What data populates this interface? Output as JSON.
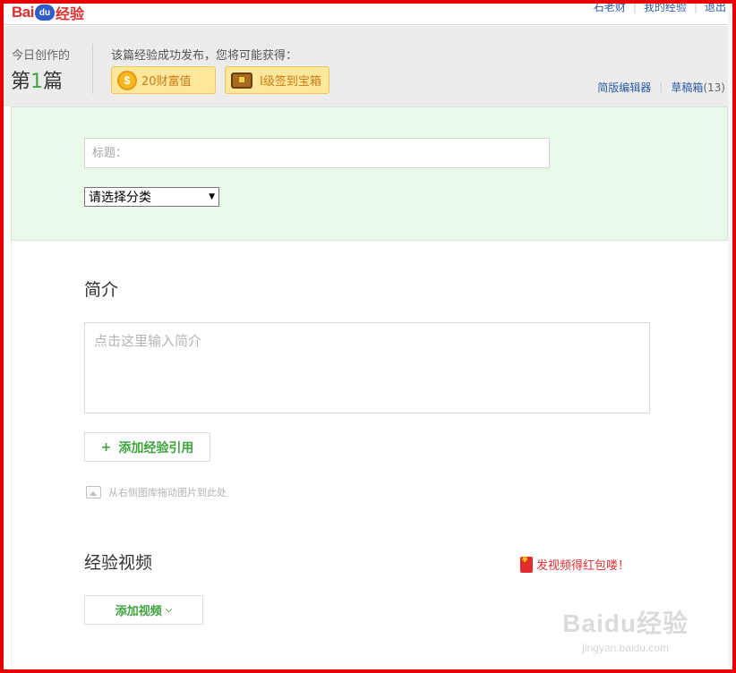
{
  "topbar": {
    "logo_text_left": "Bai",
    "logo_paw_text": "du",
    "logo_text_right": "经验",
    "links": [
      "石老财",
      "我的经验",
      "退出"
    ]
  },
  "header": {
    "today_label": "今日创作的",
    "today_prefix": "第",
    "today_number": "1",
    "today_suffix": "篇",
    "reward_title": "该篇经验成功发布，您将可能获得：",
    "reward_wealth": "20财富值",
    "reward_chest": "Ⅰ级签到宝箱",
    "simple_editor_link": "简版编辑器",
    "drafts_link": "草稿箱",
    "drafts_count": "(13)"
  },
  "form": {
    "title_placeholder": "标题：",
    "category_selected": "请选择分类"
  },
  "intro": {
    "heading": "简介",
    "placeholder": "点击这里输入简介",
    "add_reference_label": "添加经验引用",
    "drag_hint": "从右侧图库拖动图片到此处"
  },
  "video": {
    "heading": "经验视频",
    "promo": "发视频得红包喽！",
    "add_video_label": "添加视频"
  },
  "watermark": {
    "logo": "Baidu经验",
    "url": "jingyan.baidu.com"
  },
  "colors": {
    "frame": "#e60000",
    "accent_green": "#3fa33f",
    "link_blue": "#2b5aa8",
    "green_section_bg": "#eaf8ea"
  }
}
